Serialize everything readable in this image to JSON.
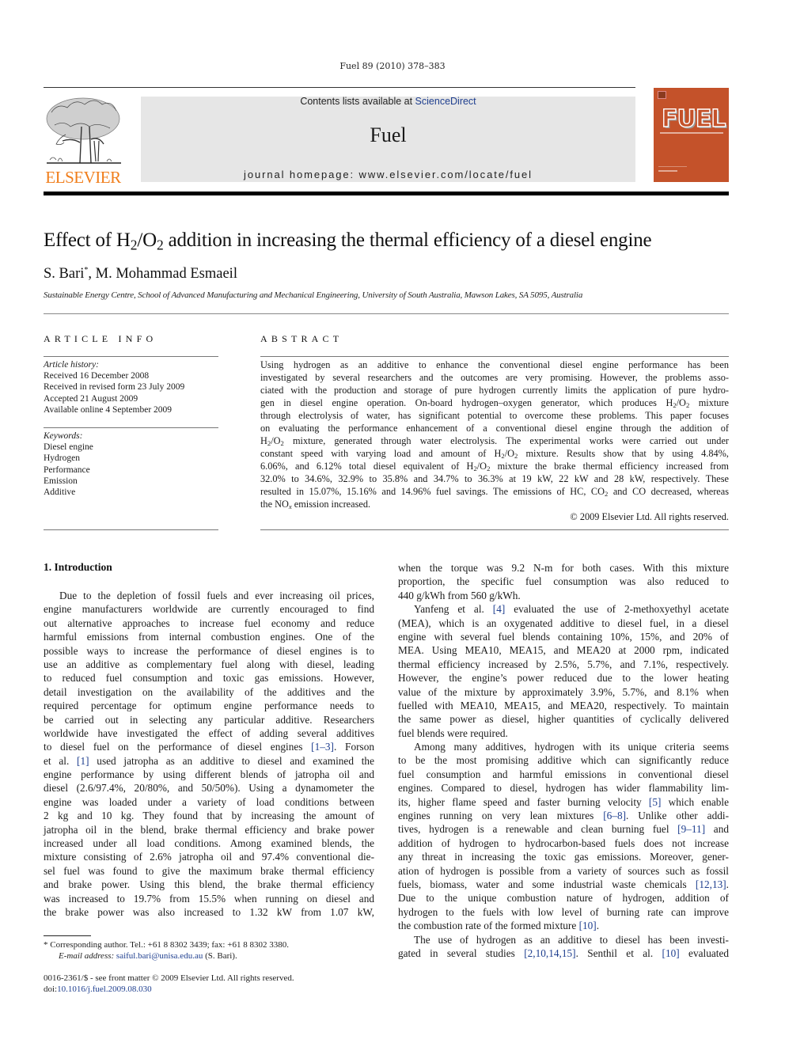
{
  "header": {
    "citation": "Fuel 89 (2010) 378–383",
    "contents_prefix": "Contents lists available at ",
    "sciencedirect_link": "ScienceDirect",
    "journal_name": "Fuel",
    "homepage": "journal homepage: www.elsevier.com/locate/fuel",
    "publisher_wordmark": "ELSEVIER",
    "cover_title": "FUEL",
    "colors": {
      "publisher_orange": "#f07d1a",
      "cover_orange": "#c4522a",
      "link_blue": "#1f3f8f",
      "header_grey": "#e6e6e6"
    }
  },
  "article": {
    "title_part1": "Effect of H",
    "title_sub1": "2",
    "title_part2": "/O",
    "title_sub2": "2",
    "title_part3": " addition in increasing the thermal efficiency of a diesel engine",
    "author1": "S. Bari",
    "author1_mark": "*",
    "author2": ", M. Mohammad Esmaeil",
    "affiliation": "Sustainable Energy Centre, School of Advanced Manufacturing and Mechanical Engineering, University of South Australia, Mawson Lakes, SA 5095, Australia"
  },
  "article_info": {
    "heading": "ARTICLE INFO",
    "history_label": "Article history:",
    "history": [
      "Received 16 December 2008",
      "Received in revised form 23 July 2009",
      "Accepted 21 August 2009",
      "Available online 4 September 2009"
    ],
    "keywords_label": "Keywords:",
    "keywords": [
      "Diesel engine",
      "Hydrogen",
      "Performance",
      "Emission",
      "Additive"
    ]
  },
  "abstract": {
    "heading": "ABSTRACT",
    "lines": [
      "Using hydrogen as an additive to enhance the conventional diesel engine performance has been",
      "investigated by several researchers and the outcomes are very promising. However, the problems asso-",
      "ciated with the production and storage of pure hydrogen currently limits the application of pure hydro-",
      "gen in diesel engine operation. On-board hydrogen–oxygen generator, which produces H₂/O₂ mixture",
      "through electrolysis of water, has significant potential to overcome these problems. This paper focuses",
      "on evaluating the performance enhancement of a conventional diesel engine through the addition of",
      "H₂/O₂ mixture, generated through water electrolysis. The experimental works were carried out under",
      "constant speed with varying load and amount of H₂/O₂ mixture. Results show that by using 4.84%,",
      "6.06%, and 6.12% total diesel equivalent of H₂/O₂ mixture the brake thermal efficiency increased from",
      "32.0% to 34.6%, 32.9% to 35.8% and 34.7% to 36.3% at 19 kW, 22 kW and 28 kW, respectively. These",
      "resulted in 15.07%, 15.16% and 14.96% fuel savings. The emissions of HC, CO₂ and CO decreased, whereas",
      "the NOₓ emission increased."
    ],
    "copyright": "© 2009 Elsevier Ltd. All rights reserved."
  },
  "intro": {
    "heading": "1. Introduction",
    "left_column": [
      {
        "t": "Due to the depletion of fossil fuels and ever increasing oil prices,",
        "indent": true
      },
      {
        "t": "engine manufacturers worldwide are currently encouraged to find"
      },
      {
        "t": "out alternative approaches to increase fuel economy and reduce"
      },
      {
        "t": "harmful emissions from internal combustion engines. One of the"
      },
      {
        "t": "possible ways to increase the performance of diesel engines is to"
      },
      {
        "t": "use an additive as complementary fuel along with diesel, leading"
      },
      {
        "t": "to reduced fuel consumption and toxic gas emissions. However,"
      },
      {
        "t": "detail investigation on the availability of the additives and the"
      },
      {
        "t": "required percentage for optimum engine performance needs to"
      },
      {
        "t": "be carried out in selecting any particular additive. Researchers"
      },
      {
        "t": "worldwide have investigated the effect of adding several additives"
      },
      {
        "t": "to diesel fuel on the performance of diesel engines [1–3]. Forson"
      },
      {
        "t": "et al. [1] used jatropha as an additive to diesel and examined the"
      },
      {
        "t": "engine performance by using different blends of jatropha oil and"
      },
      {
        "t": "diesel (2.6/97.4%, 20/80%, and 50/50%). Using a dynamometer the"
      },
      {
        "t": "engine was loaded under a variety of load conditions between"
      },
      {
        "t": "2 kg and 10 kg. They found that by increasing the amount of"
      },
      {
        "t": "jatropha oil in the blend, brake thermal efficiency and brake power"
      },
      {
        "t": "increased under all load conditions. Among examined blends, the"
      },
      {
        "t": "mixture consisting of 2.6% jatropha oil and 97.4% conventional die-"
      },
      {
        "t": "sel fuel was found to give the maximum brake thermal efficiency"
      },
      {
        "t": "and brake power. Using this blend, the brake thermal efficiency"
      },
      {
        "t": "was increased to 19.7% from 15.5% when running on diesel and"
      },
      {
        "t": "the brake power was also increased to 1.32 kW from 1.07 kW,"
      }
    ],
    "right_column": [
      {
        "t": "when the torque was 9.2 N-m for both cases. With this mixture"
      },
      {
        "t": "proportion, the specific fuel consumption was also reduced to"
      },
      {
        "t": "440 g/kWh from 560 g/kWh.",
        "last": true
      },
      {
        "t": "Yanfeng et al. [4] evaluated the use of 2-methoxyethyl acetate",
        "indent": true
      },
      {
        "t": "(MEA), which is an oxygenated additive to diesel fuel, in a diesel"
      },
      {
        "t": "engine with several fuel blends containing 10%, 15%, and 20% of"
      },
      {
        "t": "MEA. Using MEA10, MEA15, and MEA20 at 2000 rpm, indicated"
      },
      {
        "t": "thermal efficiency increased by 2.5%, 5.7%, and 7.1%, respectively."
      },
      {
        "t": "However, the engine’s power reduced due to the lower heating"
      },
      {
        "t": "value of the mixture by approximately 3.9%, 5.7%, and 8.1% when"
      },
      {
        "t": "fuelled with MEA10, MEA15, and MEA20, respectively. To maintain"
      },
      {
        "t": "the same power as diesel, higher quantities of cyclically delivered"
      },
      {
        "t": "fuel blends were required.",
        "last": true
      },
      {
        "t": "Among many additives, hydrogen with its unique criteria seems",
        "indent": true
      },
      {
        "t": "to be the most promising additive which can significantly reduce"
      },
      {
        "t": "fuel consumption and harmful emissions in conventional diesel"
      },
      {
        "t": "engines. Compared to diesel, hydrogen has wider flammability lim-"
      },
      {
        "t": "its, higher flame speed and faster burning velocity [5] which enable"
      },
      {
        "t": "engines running on very lean mixtures [6–8]. Unlike other addi-"
      },
      {
        "t": "tives, hydrogen is a renewable and clean burning fuel [9–11] and"
      },
      {
        "t": "addition of hydrogen to hydrocarbon-based fuels does not increase"
      },
      {
        "t": "any threat in increasing the toxic gas emissions. Moreover, gener-"
      },
      {
        "t": "ation of hydrogen is possible from a variety of sources such as fossil"
      },
      {
        "t": "fuels, biomass, water and some industrial waste chemicals [12,13]."
      },
      {
        "t": "Due to the unique combustion nature of hydrogen, addition of"
      },
      {
        "t": "hydrogen to the fuels with low level of burning rate can improve"
      },
      {
        "t": "the combustion rate of the formed mixture [10].",
        "last": true
      },
      {
        "t": "The use of hydrogen as an additive to diesel has been investi-",
        "indent": true
      },
      {
        "t": "gated in several studies [2,10,14,15]. Senthil et al. [10] evaluated"
      }
    ]
  },
  "footnotes": {
    "corresponding": "*  Corresponding author. Tel.: +61 8 8302 3439; fax: +61 8 8302 3380.",
    "email_label": "E-mail address:",
    "email": "saiful.bari@unisa.edu.au",
    "email_suffix": " (S. Bari).",
    "front_matter": "0016-2361/$ - see front matter © 2009 Elsevier Ltd. All rights reserved.",
    "doi_prefix": "doi:",
    "doi": "10.1016/j.fuel.2009.08.030"
  }
}
